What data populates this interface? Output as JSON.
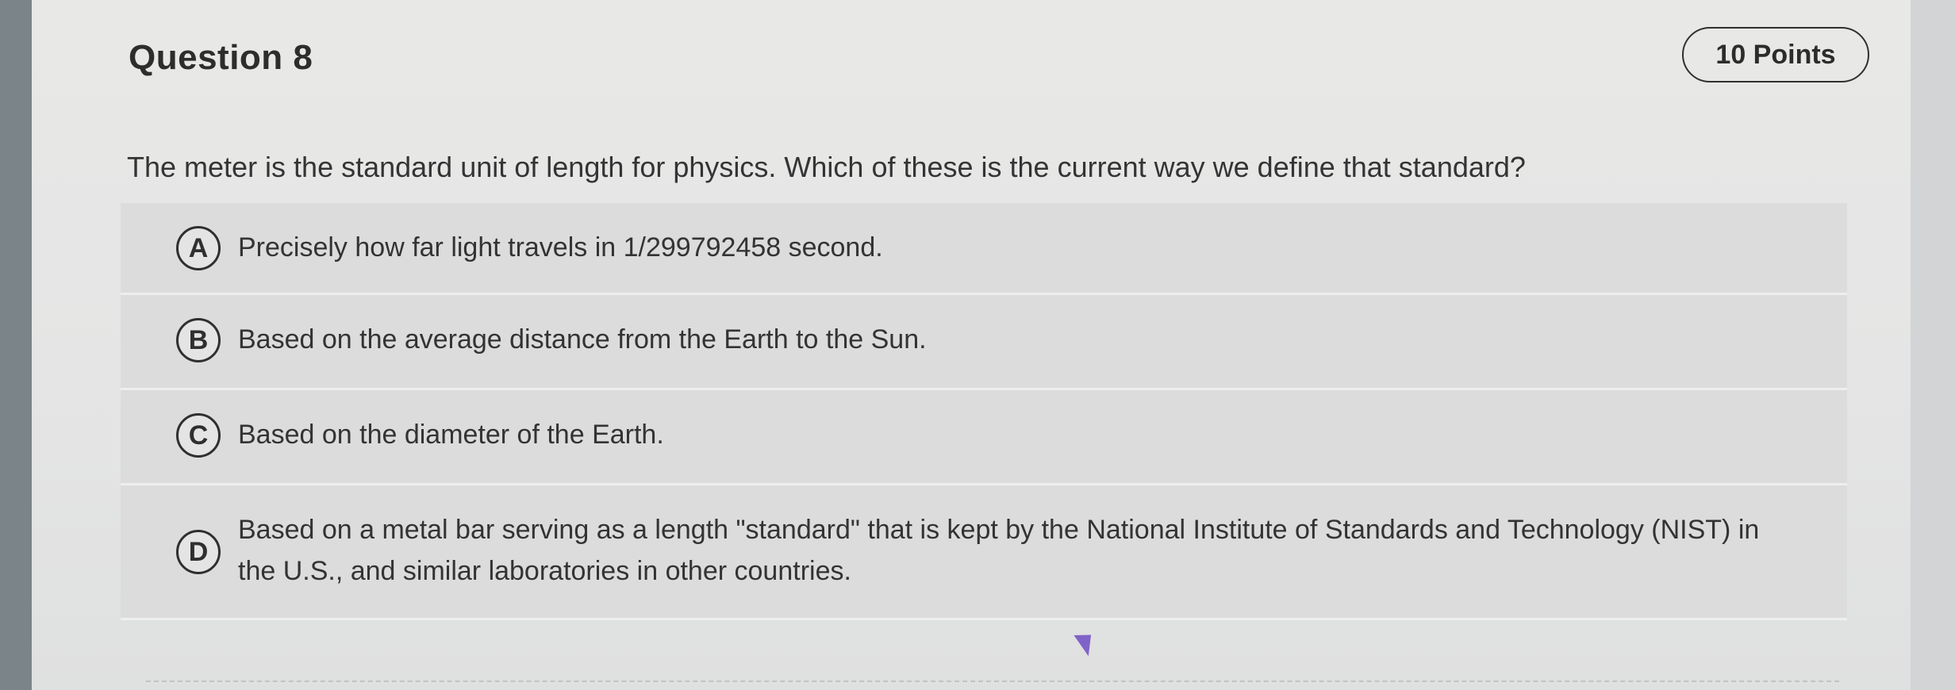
{
  "question": {
    "title": "Question 8",
    "points": "10 Points",
    "prompt": "The meter is the standard unit of length for physics. Which of these is the current way we define that standard?"
  },
  "choices": [
    {
      "letter": "A",
      "text": "Precisely how far light travels in 1/299792458 second."
    },
    {
      "letter": "B",
      "text": "Based on the average distance from the Earth to the Sun."
    },
    {
      "letter": "C",
      "text": "Based on the diameter of the Earth."
    },
    {
      "letter": "D",
      "text": "Based on a metal bar serving as a length \"standard\" that is kept by the National Institute of Standards and Technology (NIST) in the U.S., and similar laboratories in other countries."
    }
  ],
  "colors": {
    "card_background": "#e5e5e5",
    "choice_background": "#dcdcdc",
    "text": "#333333",
    "cursor": "#7a5cc7"
  },
  "icons": {
    "cursor": "mouse-pointer-icon"
  }
}
